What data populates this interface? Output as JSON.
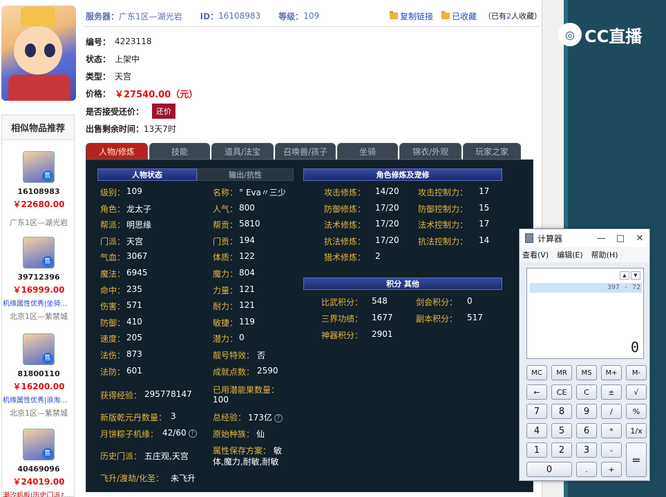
{
  "header": {
    "server_label": "服务器：",
    "server_value": "广东1区—湖光岩",
    "id_label": "ID：",
    "id_value": "16108983",
    "level_label": "等级：",
    "level_value": "109",
    "copy_link": "复制链接",
    "favorited": "已收藏",
    "fav_count_prefix": "（已有",
    "fav_count": "2",
    "fav_count_suffix": "人收藏）"
  },
  "listing": {
    "serial_label": "编号：",
    "serial_value": "4223118",
    "status_label": "状态：",
    "status_value": "上架中",
    "type_label": "类型：",
    "type_value": "天宫",
    "price_label": "价格：",
    "price_value": "￥27540.00（元）",
    "bargain_label": "是否接受还价：",
    "bargain_button": "还价",
    "remaining_label": "出售剩余时间：",
    "remaining_value": "13天7时"
  },
  "similar": {
    "title": "相似物品推荐",
    "badge": "售",
    "items": [
      {
        "id": "16108983",
        "price": "￥22680.00",
        "desc": "",
        "server": "广东1区—湖光岩"
      },
      {
        "id": "39712396",
        "price": "￥16999.00",
        "desc": "机缘属性优秀|坐骑…",
        "server": "北京1区—紫禁城"
      },
      {
        "id": "81800110",
        "price": "￥16200.00",
        "desc": "机缘属性优秀|浪淘…",
        "server": "北京1区—紫禁城"
      },
      {
        "id": "40469096",
        "price": "￥24019.00",
        "desc": "潮汐帆板|历史门派?…",
        "server": ""
      }
    ]
  },
  "tabs": [
    {
      "label": "人物/修炼",
      "active": true
    },
    {
      "label": "技能",
      "active": false
    },
    {
      "label": "道具/法宝",
      "active": false
    },
    {
      "label": "召唤兽/孩子",
      "active": false
    },
    {
      "label": "坐骑",
      "active": false
    },
    {
      "label": "锦衣/外观",
      "active": false
    },
    {
      "label": "玩家之家",
      "active": false
    }
  ],
  "panel": {
    "status_head": "人物状态",
    "output_head": "输出/抗性",
    "cultivation_head": "角色修炼及宠修",
    "points_head": "积分 其他",
    "left_stats": [
      {
        "k": "级别：",
        "v": "109"
      },
      {
        "k": "角色：",
        "v": "龙太子"
      },
      {
        "k": "帮派：",
        "v": "明思缘"
      },
      {
        "k": "门派：",
        "v": "天宫"
      },
      {
        "k": "气血：",
        "v": "3067"
      },
      {
        "k": "魔法：",
        "v": "6945"
      },
      {
        "k": "命中：",
        "v": "235"
      },
      {
        "k": "伤害：",
        "v": "571"
      },
      {
        "k": "防御：",
        "v": "410"
      },
      {
        "k": "速度：",
        "v": "205"
      },
      {
        "k": "法伤：",
        "v": "873"
      },
      {
        "k": "法防：",
        "v": "601"
      }
    ],
    "mid_stats": [
      {
        "k": "名称：",
        "v": "° Eva〃三少"
      },
      {
        "k": "人气：",
        "v": "800"
      },
      {
        "k": "帮贡：",
        "v": "5810"
      },
      {
        "k": "门贡：",
        "v": "194"
      },
      {
        "k": "体质：",
        "v": "122"
      },
      {
        "k": "魔力：",
        "v": "804"
      },
      {
        "k": "力量：",
        "v": "121"
      },
      {
        "k": "耐力：",
        "v": "121"
      },
      {
        "k": "敏捷：",
        "v": "119"
      },
      {
        "k": "潜力：",
        "v": "0"
      },
      {
        "k": "靓号特效：",
        "v": "否"
      },
      {
        "k": "成就点数：",
        "v": "2590"
      }
    ],
    "exp_label": "获得经验：",
    "exp_value": "295778147",
    "potential_fruit_label": "已用潜能果数量：",
    "potential_fruit_value": "100",
    "qianyuan_label": "新版乾元丹数量：",
    "qianyuan_value": "3",
    "total_exp_label": "总经验：",
    "total_exp_value": "173亿",
    "zongzi_label": "月饼粽子机缘：",
    "zongzi_value": "42/60",
    "race_label": "原始种族：",
    "race_value": "仙",
    "history_label": "历史门派：",
    "history_value": "五庄观,天宫",
    "attr_plan_label": "属性保存方案：",
    "attr_plan_value_1": "敏",
    "attr_plan_value_2": "体,魔力,耐敏,耐敏",
    "ascend_label": "飞升/渡劫/化圣：",
    "ascend_value": "未飞升",
    "cultivation": [
      {
        "k": "攻击修炼：",
        "v": "14/20",
        "k2": "攻击控制力：",
        "v2": "17"
      },
      {
        "k": "防御修炼：",
        "v": "17/20",
        "k2": "防御控制力：",
        "v2": "15"
      },
      {
        "k": "法术修炼：",
        "v": "17/20",
        "k2": "法术控制力：",
        "v2": "17"
      },
      {
        "k": "抗法修炼：",
        "v": "17/20",
        "k2": "抗法控制力：",
        "v2": "14"
      },
      {
        "k": "猎术修炼：",
        "v": "2",
        "k2": "",
        "v2": ""
      }
    ],
    "points": [
      {
        "k": "比武积分：",
        "v": "548",
        "k2": "剑会积分：",
        "v2": "0"
      },
      {
        "k": "三界功绩：",
        "v": "1677",
        "k2": "副本积分：",
        "v2": "517"
      },
      {
        "k": "神器积分：",
        "v": "2901",
        "k2": "",
        "v2": ""
      }
    ]
  },
  "calculator": {
    "title": "计算器",
    "menu": [
      "查看(V)",
      "编辑(E)",
      "帮助(H)"
    ],
    "history": "397 - 72",
    "display": "0",
    "buttons": [
      [
        "MC",
        "MR",
        "MS",
        "M+",
        "M-"
      ],
      [
        "←",
        "CE",
        "C",
        "±",
        "√"
      ],
      [
        "7",
        "8",
        "9",
        "/",
        "%"
      ],
      [
        "4",
        "5",
        "6",
        "*",
        "1/x"
      ],
      [
        "1",
        "2",
        "3",
        "-",
        "="
      ],
      [
        "0",
        ".",
        "+"
      ]
    ]
  },
  "overlay": {
    "logo_text": "CC直播"
  }
}
